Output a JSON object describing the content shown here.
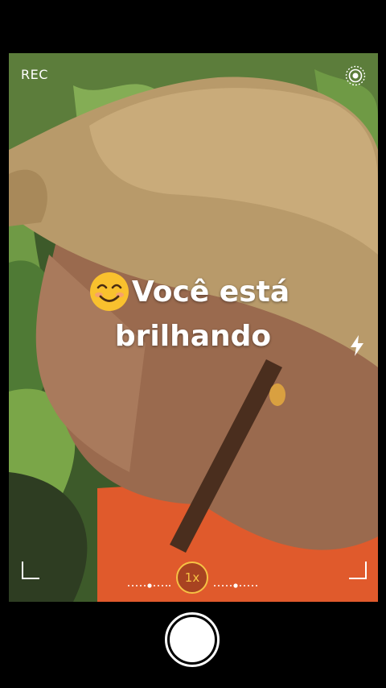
{
  "camera": {
    "rec_label": "REC",
    "live_icon": "live-photo-icon",
    "flash_icon": "flash-icon",
    "zoom_label": "1x",
    "shutter_icon": "shutter-button"
  },
  "caption": {
    "emoji": "smiling-face-emoji",
    "line1": "Você está",
    "line2": "brilhando"
  },
  "colors": {
    "accent": "#f6c244",
    "frame": "#000000"
  }
}
